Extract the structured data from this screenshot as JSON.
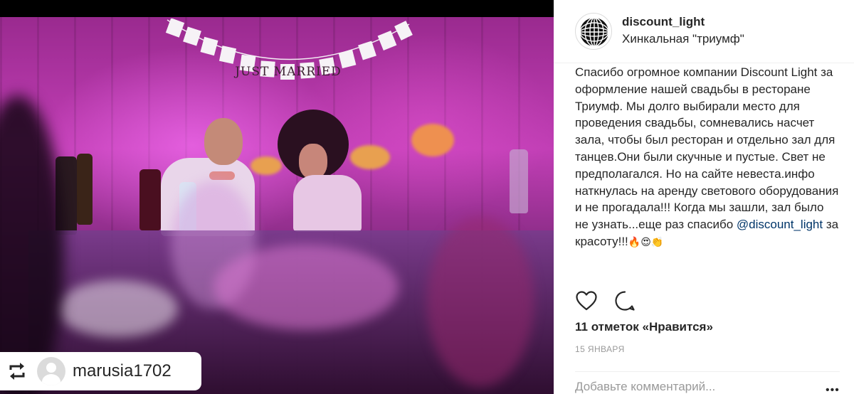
{
  "post": {
    "username": "discount_light",
    "location": "Хинкальная \"триумф\"",
    "image_alt": "",
    "banner_text": "JUST MARRIED",
    "regram": {
      "username": "marusia1702",
      "icon": "repost-icon"
    },
    "caption": {
      "text": "Спасибо огромное компании Discount Light за оформление нашей свадьбы в ресторане Триумф. Мы долго выбирали место для проведения свадьбы, сомневались насчет зала, чтобы был ресторан и отдельно зал для танцев.Они были скучные и пустые. Свет не предполагался. Но на сайте невеста.инфо наткнулась на аренду светового оборудования и не прогадала!!! Когда мы зашли, зал было не узнать...еще раз спасибо",
      "mention": "@discount_light",
      "tail": " за красоту!!!",
      "emojis": "🔥😍👏"
    },
    "actions": {
      "like_icon": "heart-icon",
      "comment_icon": "comment-icon"
    },
    "likes": "11 отметок «Нравится»",
    "date": "15 ЯНВАРЯ",
    "comment_placeholder": "Добавьте комментарий...",
    "more": "•••"
  },
  "colors": {
    "text": "#262626",
    "secondary": "#999999",
    "mention": "#003569",
    "divider": "#efefef",
    "photo_accent": "#c23fb6"
  }
}
